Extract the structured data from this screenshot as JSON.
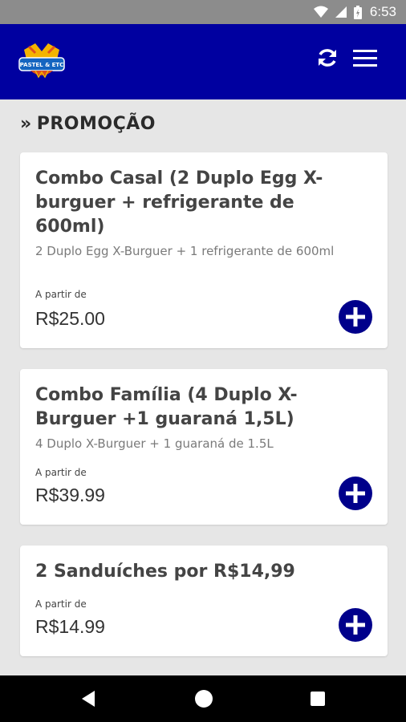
{
  "status_bar": {
    "time": "6:53"
  },
  "app_bar": {
    "logo_text": "PASTEL & ETC",
    "refresh_icon": "refresh-icon",
    "menu_icon": "hamburger-menu-icon",
    "color": "#0000a0"
  },
  "section": {
    "chevron": "»",
    "title": "PROMOÇÃO"
  },
  "products": [
    {
      "title": "Combo Casal (2 Duplo Egg X-burguer + refrigerante de 600ml)",
      "description": "2 Duplo Egg X-Burguer + 1 refrigerante de 600ml",
      "from_label": "A partir de",
      "price": "R$25.00"
    },
    {
      "title": "Combo Família (4 Duplo X-Burguer +1 guaraná 1,5L)",
      "description": "4 Duplo X-Burguer + 1 guaraná de 1.5L",
      "from_label": "A partir de",
      "price": "R$39.99"
    },
    {
      "title": "2 Sanduíches por R$14,99",
      "description": "",
      "from_label": "A partir de",
      "price": "R$14.99"
    }
  ],
  "colors": {
    "accent": "#00008b",
    "background": "#e6e6e6"
  }
}
